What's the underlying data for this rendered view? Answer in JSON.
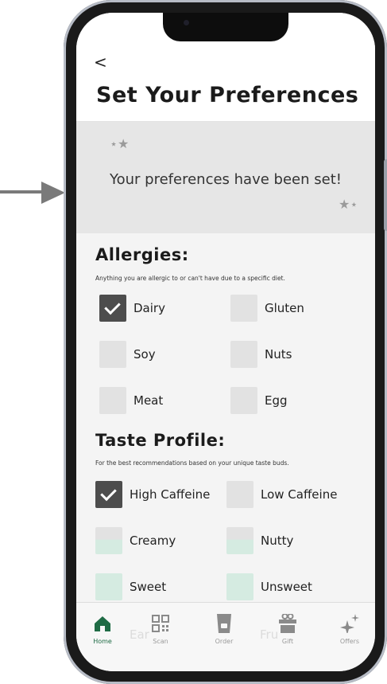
{
  "header": {
    "back_label": "<",
    "title": "Set Your Preferences"
  },
  "banner": {
    "message": "Your preferences have been set!"
  },
  "allergies": {
    "title": "Allergies:",
    "subtitle": "Anything you are allergic to or can't have due to a specific diet.",
    "options": [
      {
        "label": "Dairy",
        "checked": true
      },
      {
        "label": "Gluten",
        "checked": false
      },
      {
        "label": "Soy",
        "checked": false
      },
      {
        "label": "Nuts",
        "checked": false
      },
      {
        "label": "Meat",
        "checked": false
      },
      {
        "label": "Egg",
        "checked": false
      }
    ]
  },
  "taste": {
    "title": "Taste Profile:",
    "subtitle": "For the best recommendations based on your unique taste buds.",
    "options": [
      {
        "label": "High Caffeine",
        "checked": true
      },
      {
        "label": "Low Caffeine",
        "checked": false
      },
      {
        "label": "Creamy",
        "checked": false
      },
      {
        "label": "Nutty",
        "checked": false
      },
      {
        "label": "Sweet",
        "checked": false
      },
      {
        "label": "Unsweet",
        "checked": false
      }
    ]
  },
  "ghost_text": {
    "left": "Ear",
    "right": "Fru"
  },
  "tabbar": {
    "tabs": [
      {
        "label": "Home",
        "icon": "home-icon",
        "active": true
      },
      {
        "label": "Scan",
        "icon": "qr-code-icon",
        "active": false
      },
      {
        "label": "Order",
        "icon": "cup-icon",
        "active": false
      },
      {
        "label": "Gift",
        "icon": "gift-icon",
        "active": false
      },
      {
        "label": "Offers",
        "icon": "sparkle-icon",
        "active": false
      }
    ]
  },
  "colors": {
    "accent_green": "#1f6b45",
    "checked_box": "#4d4d4d",
    "unchecked_box": "#e2e2e2",
    "mint_box": "#d5ebe1"
  }
}
